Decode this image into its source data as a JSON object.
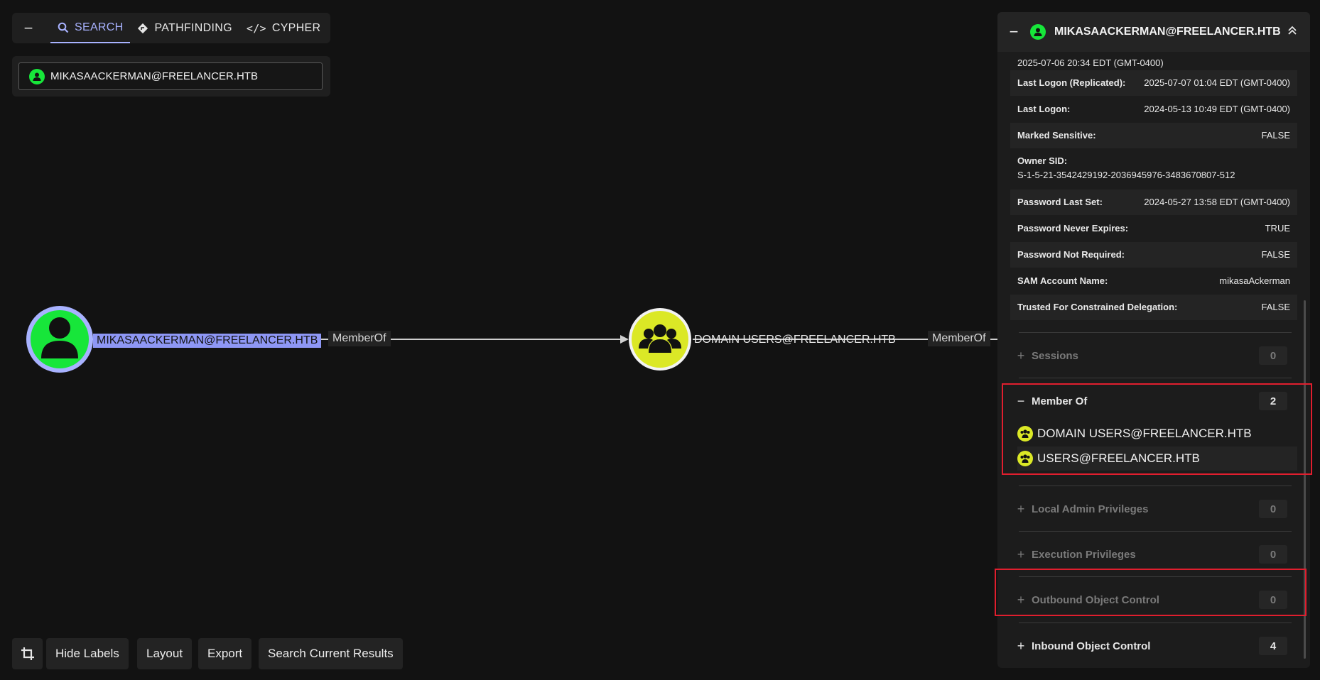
{
  "tabs": {
    "collapse_icon": "minus-icon",
    "items": [
      {
        "label": "SEARCH",
        "icon": "search-icon",
        "active": true
      },
      {
        "label": "PATHFINDING",
        "icon": "directions-icon",
        "active": false
      },
      {
        "label": "CYPHER",
        "icon": "code-icon",
        "active": false
      }
    ]
  },
  "search": {
    "value": "MIKASAACKERMAN@FREELANCER.HTB"
  },
  "graph": {
    "nodes": [
      {
        "label": "MIKASAACKERMAN@FREELANCER.HTB",
        "type": "user",
        "color": "#17e63a",
        "selected": true
      },
      {
        "label": "DOMAIN USERS@FREELANCER.HTB",
        "type": "group",
        "color": "#dbe826"
      },
      {
        "label": "USERS@FREELANCER.HTB",
        "type": "group",
        "color": "#dbe826"
      }
    ],
    "edges": [
      {
        "label": "MemberOf"
      },
      {
        "label": "MemberOf"
      }
    ]
  },
  "toolbar": {
    "crop_icon": "crop-icon",
    "hide_labels": "Hide Labels",
    "layout": "Layout",
    "export": "Export",
    "search_current": "Search Current Results"
  },
  "entity_panel": {
    "title": "MIKASAACKERMAN@FREELANCER.HTB",
    "properties": {
      "top_value": "2025-07-06 20:34 EDT (GMT-0400)",
      "rows": [
        {
          "key": "Last Logon (Replicated):",
          "value": "2025-07-07 01:04 EDT (GMT-0400)"
        },
        {
          "key": "Last Logon:",
          "value": "2024-05-13 10:49 EDT (GMT-0400)"
        },
        {
          "key": "Marked Sensitive:",
          "value": "FALSE"
        },
        {
          "key": "Owner SID:",
          "value": "S-1-5-21-3542429192-2036945976-3483670807-512"
        },
        {
          "key": "Password Last Set:",
          "value": "2024-05-27 13:58 EDT (GMT-0400)"
        },
        {
          "key": "Password Never Expires:",
          "value": "TRUE"
        },
        {
          "key": "Password Not Required:",
          "value": "FALSE"
        },
        {
          "key": "SAM Account Name:",
          "value": "mikasaAckerman"
        },
        {
          "key": "Trusted For Constrained Delegation:",
          "value": "FALSE"
        }
      ]
    },
    "sections": {
      "sessions": {
        "label": "Sessions",
        "count": "0",
        "sign": "+"
      },
      "member_of": {
        "label": "Member Of",
        "count": "2",
        "sign": "−",
        "items": [
          "DOMAIN USERS@FREELANCER.HTB",
          "USERS@FREELANCER.HTB"
        ]
      },
      "local_admin": {
        "label": "Local Admin Privileges",
        "count": "0",
        "sign": "+"
      },
      "execution": {
        "label": "Execution Privileges",
        "count": "0",
        "sign": "+"
      },
      "outbound": {
        "label": "Outbound Object Control",
        "count": "0",
        "sign": "+"
      },
      "inbound": {
        "label": "Inbound Object Control",
        "count": "4",
        "sign": "+"
      }
    }
  },
  "colors": {
    "accent": "#a8b2ff",
    "user": "#17e63a",
    "group": "#dbe826",
    "highlight": "#e01e2e"
  }
}
